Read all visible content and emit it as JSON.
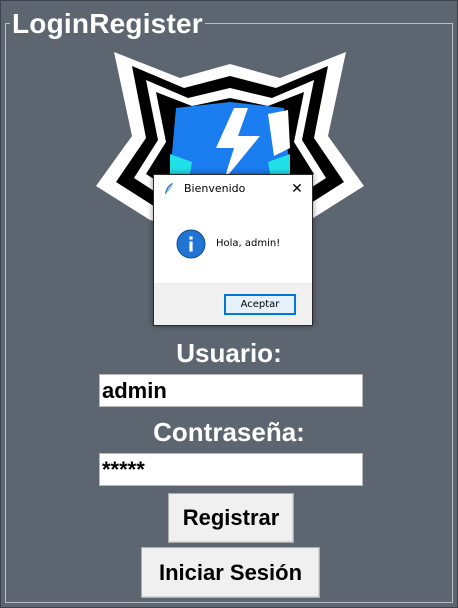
{
  "window": {
    "group_title": "LoginRegister"
  },
  "form": {
    "username_label": "Usuario:",
    "username_value": "admin",
    "password_label": "Contraseña:",
    "password_value": "*****",
    "register_button": "Registrar",
    "login_button": "Iniciar Sesión"
  },
  "dialog": {
    "title": "Bienvenido",
    "close_glyph": "✕",
    "message": "Hola, admin!",
    "ok_button": "Aceptar",
    "icon": "info-icon"
  },
  "colors": {
    "background": "#5d6670",
    "logo_blue": "#1a7df0",
    "logo_cyan": "#20e0e8",
    "dialog_accent": "#0078d7"
  }
}
